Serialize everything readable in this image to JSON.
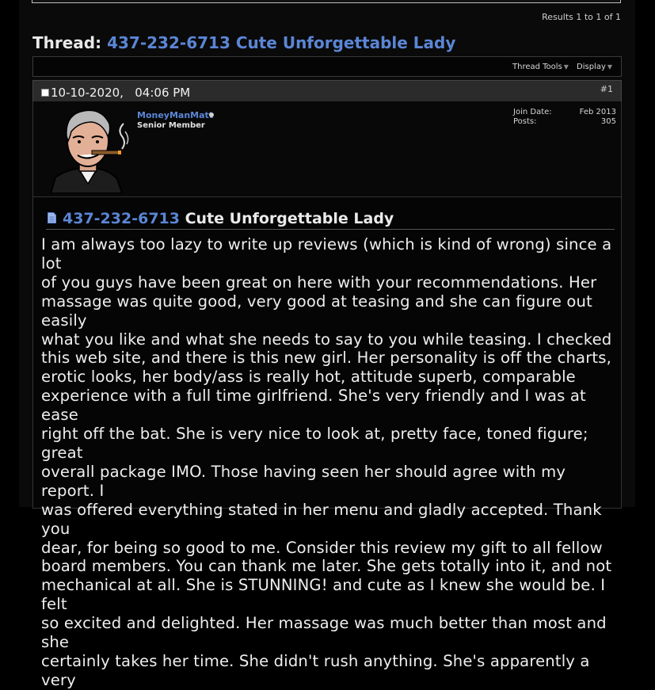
{
  "results": "Results 1 to 1 of 1",
  "thread": {
    "prefix": "Thread:",
    "title": "437-232-6713 Cute Unforgettable Lady"
  },
  "toolbar": {
    "thread_tools": "Thread Tools",
    "display": "Display"
  },
  "post": {
    "date": "10-10-2020,",
    "time": "04:06 PM",
    "number": "#1",
    "user": {
      "name": "MoneyManMatt",
      "title": "Senior Member",
      "join_label": "Join Date:",
      "join_value": "Feb 2013",
      "posts_label": "Posts:",
      "posts_value": "305"
    },
    "title_phone": "437-232-6713",
    "title_rest": "Cute Unforgettable Lady",
    "lines": [
      "I am always too lazy to write up reviews (which is kind of wrong) since a lot",
      "of you guys have been great on here with your recommendations. Her",
      "massage was quite good, very good at teasing and she can figure out easily",
      "what you like and what she needs to say to you while teasing. I checked",
      "this web site, and there is this new girl. Her personality is off the charts,",
      "erotic looks, her body/ass is really hot, attitude superb, comparable",
      "experience with a full time girlfriend. She's very friendly and I was at ease",
      "right off the bat. She is very nice to look at, pretty face, toned figure; great",
      "overall package IMO. Those having seen her should agree with my report. I",
      "was offered everything stated in her menu and gladly accepted. Thank you",
      "dear, for being so good to me. Consider this review my gift to all fellow",
      "board members. You can thank me later. She gets totally into it, and not",
      "mechanical at all. She is STUNNING! and cute as I knew she would be. I felt",
      "so excited and delighted. Her massage was much better than most and she",
      "certainly takes her time. She didn't rush anything. She's apparently a very"
    ]
  }
}
